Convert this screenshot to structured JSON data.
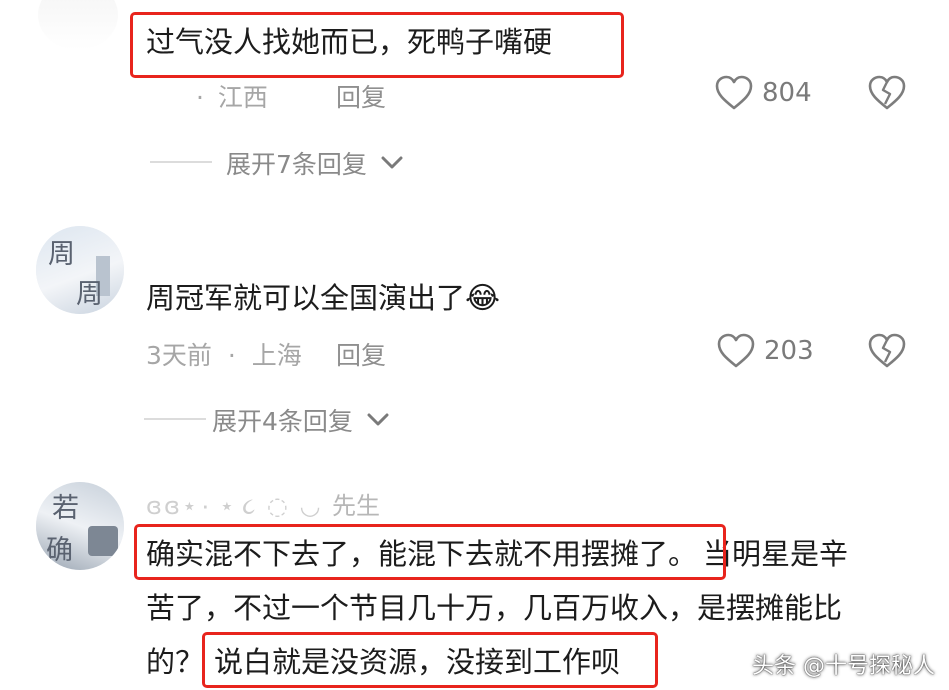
{
  "comments": [
    {
      "text": "过气没人找她而已，死鸭子嘴硬",
      "location": "江西",
      "reply_label": "回复",
      "likes": "804",
      "expand_replies": "展开7条回复"
    },
    {
      "avatar_chars": [
        "周",
        "周"
      ],
      "text": "周冠军就可以全国演出了",
      "emoji": "😂",
      "time": "3天前",
      "location": "上海",
      "reply_label": "回复",
      "likes": "203",
      "expand_replies": "展开4条回复"
    },
    {
      "avatar_chars": [
        "若",
        "确"
      ],
      "username": "先生",
      "text_line1_hl": "确实混不下去了，能混下去就不用摆摊了。",
      "text_line1_rest": "当明星是辛",
      "text_line2": "苦了，不过一个节目几十万，几百万收入，是摆摊能比",
      "text_line3_start": "的？",
      "text_line3_hl": "说白就是没资源，没接到工作呗"
    }
  ],
  "meta_separator": "·",
  "watermark": "头条 @十号探秘人",
  "colors": {
    "highlight": "#e8241d",
    "meta": "#a6a6a6",
    "text": "#1c1c1c"
  },
  "icons": {
    "like": "heart-outline-icon",
    "dislike": "broken-heart-icon",
    "expand": "chevron-down-icon"
  }
}
